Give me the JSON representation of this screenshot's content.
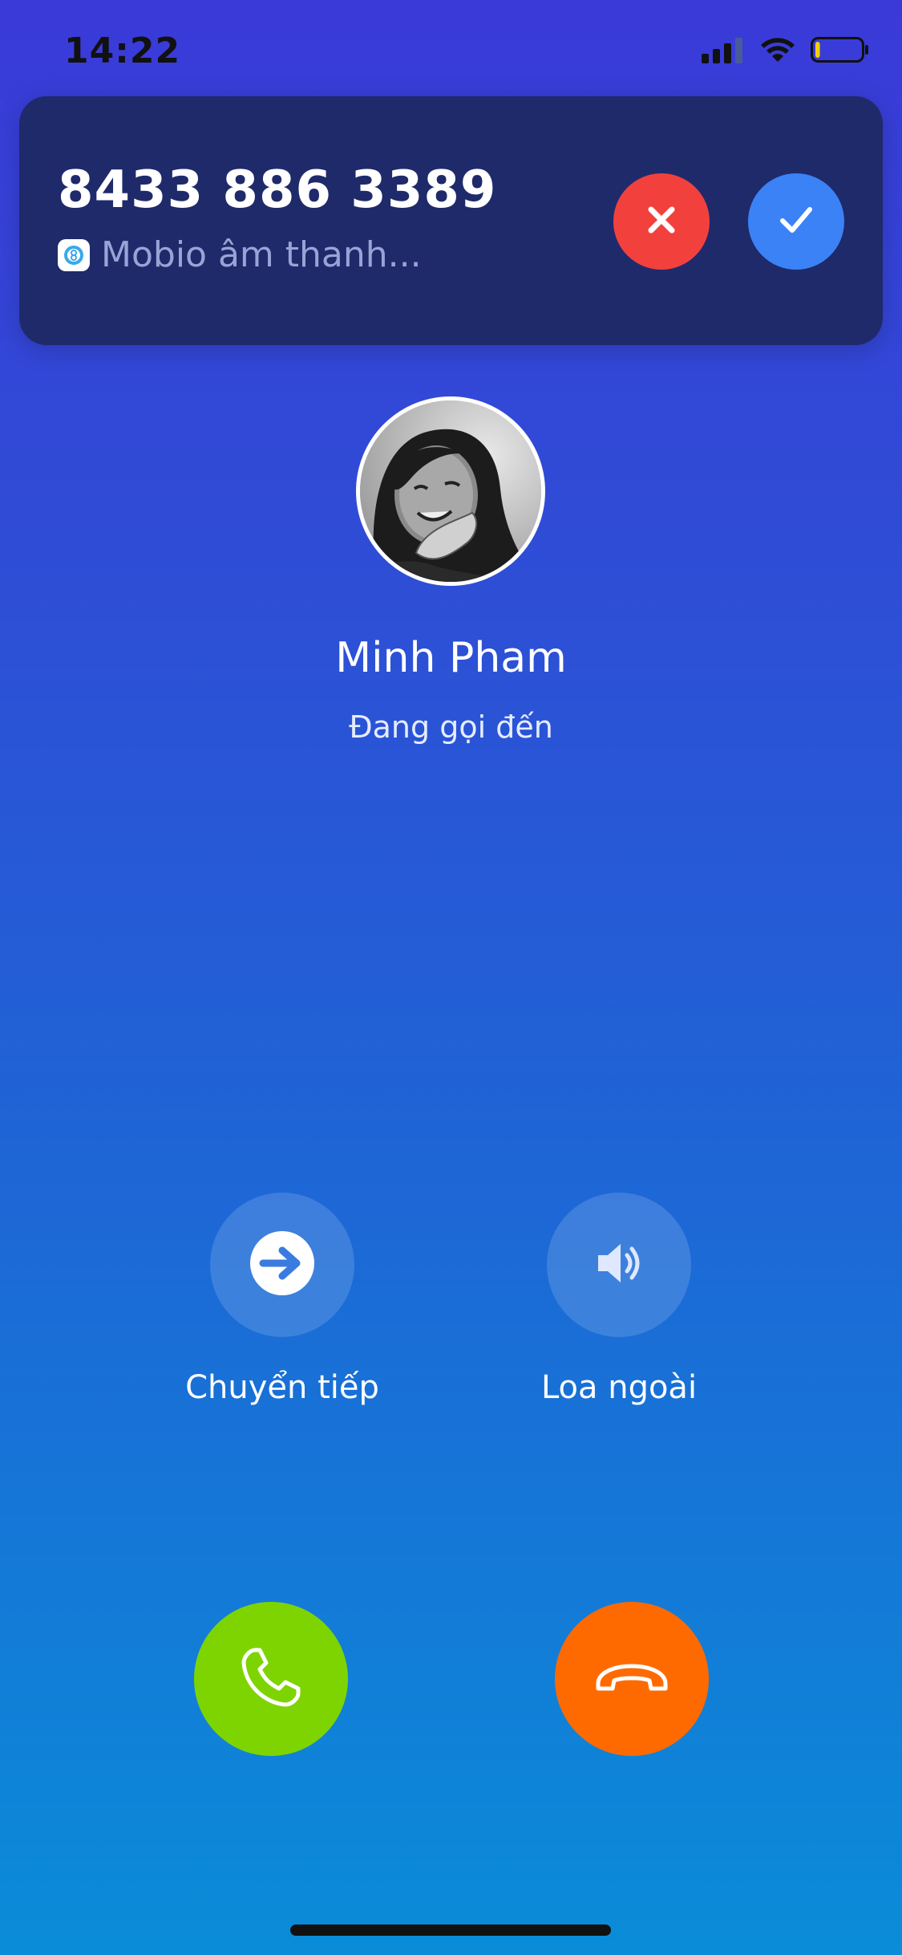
{
  "status_bar": {
    "time": "14:22",
    "icons": [
      "cellular-signal-icon",
      "wifi-icon",
      "battery-low-icon"
    ],
    "battery_level": 0.1
  },
  "incoming_banner": {
    "phone_number": "8433 886 3389",
    "app_label": "Mobio âm thanh...",
    "app_icon": "mobio-app-icon",
    "decline_icon": "close-icon",
    "accept_icon": "check-icon",
    "decline_color": "#f2413d",
    "accept_color": "#3b82f6"
  },
  "caller": {
    "name": "Minh Pham",
    "status": "Đang gọi đến",
    "avatar": "caller-avatar-photo"
  },
  "actions": [
    {
      "label": "Chuyển tiếp",
      "icon": "forward-arrow-icon"
    },
    {
      "label": "Loa ngoài",
      "icon": "speaker-icon"
    }
  ],
  "call_buttons": {
    "answer_icon": "phone-icon",
    "answer_color": "#7ed400",
    "end_icon": "hang-up-icon",
    "end_color": "#ff6a00"
  }
}
